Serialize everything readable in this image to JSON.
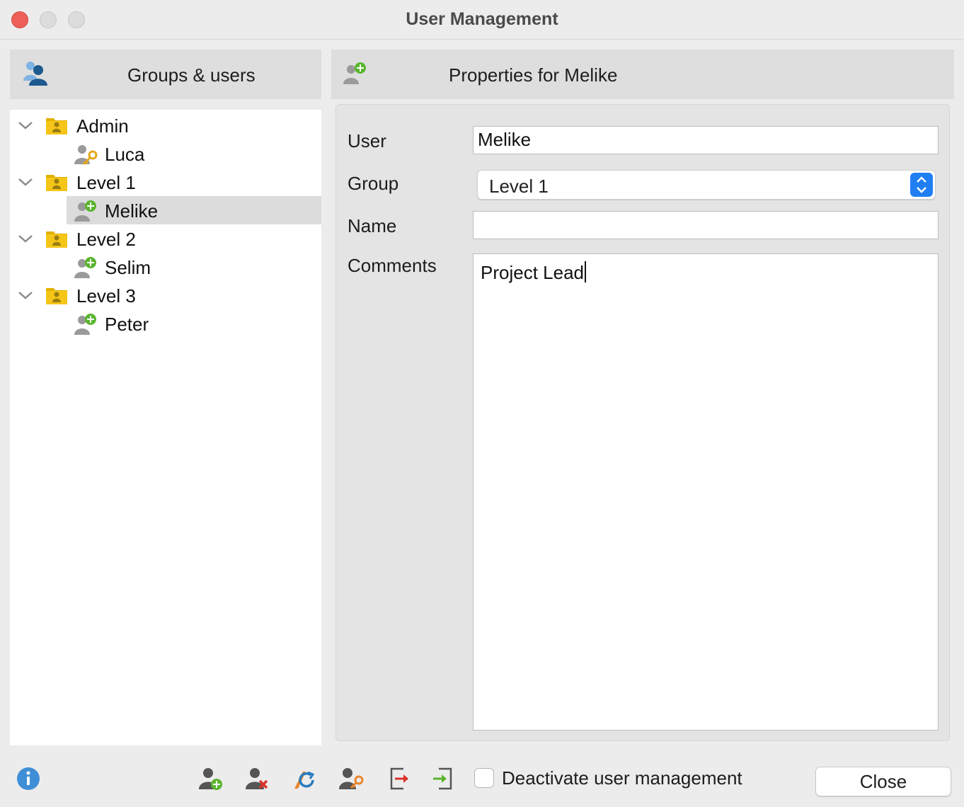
{
  "window": {
    "title": "User Management"
  },
  "left_pane": {
    "header": "Groups & users",
    "tree": [
      {
        "type": "group",
        "label": "Admin",
        "expanded": true,
        "icon": "group-folder-icon"
      },
      {
        "type": "user",
        "label": "Luca",
        "icon": "admin-key-user-icon"
      },
      {
        "type": "group",
        "label": "Level 1",
        "expanded": true,
        "icon": "group-folder-icon"
      },
      {
        "type": "user",
        "label": "Melike",
        "icon": "user-add-icon",
        "selected": true
      },
      {
        "type": "group",
        "label": "Level 2",
        "expanded": true,
        "icon": "group-folder-icon"
      },
      {
        "type": "user",
        "label": "Selim",
        "icon": "user-add-icon"
      },
      {
        "type": "group",
        "label": "Level 3",
        "expanded": true,
        "icon": "group-folder-icon"
      },
      {
        "type": "user",
        "label": "Peter",
        "icon": "user-add-icon"
      }
    ]
  },
  "right_pane": {
    "header": "Properties for Melike",
    "fields": {
      "user_label": "User",
      "user_value": "Melike",
      "group_label": "Group",
      "group_value": "Level 1",
      "name_label": "Name",
      "name_value": "",
      "comments_label": "Comments",
      "comments_value": "Project Lead"
    }
  },
  "bottom_bar": {
    "icons": [
      "info-icon",
      "add-user-icon",
      "delete-user-icon",
      "refresh-user-icon",
      "user-password-icon",
      "export-icon",
      "import-icon"
    ],
    "deactivate_label": "Deactivate user management",
    "deactivate_checked": false,
    "close_label": "Close"
  },
  "colors": {
    "group_folder": "#f5c518",
    "add_badge": "#5ab52e",
    "delete_badge": "#d9332b",
    "key": "#e5a81b",
    "select_accent": "#1f7ff2",
    "info": "#3f8fd6"
  }
}
